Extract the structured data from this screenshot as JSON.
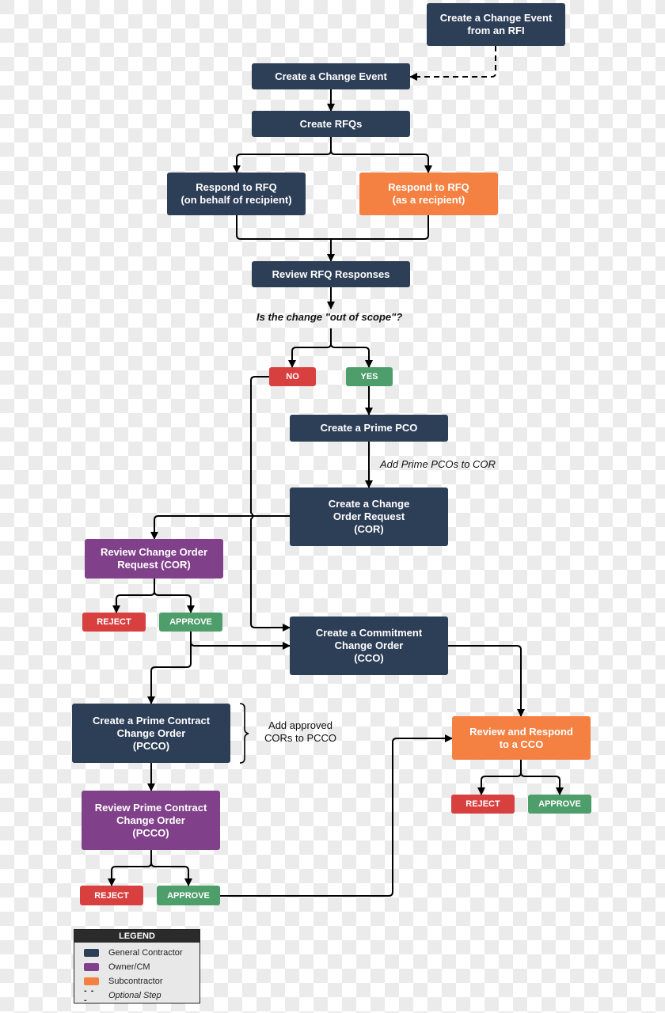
{
  "colors": {
    "general_contractor": "#2d3e57",
    "owner_cm": "#81418a",
    "subcontractor": "#f48042",
    "reject": "#d84040",
    "approve": "#4d9e6a"
  },
  "nodes": {
    "ce_from_rfi": "Create a Change Event\nfrom an RFI",
    "create_ce": "Create a Change Event",
    "create_rfqs": "Create RFQs",
    "respond_behalf": "Respond to RFQ\n(on behalf of recipient)",
    "respond_recipient": "Respond to RFQ\n(as a recipient)",
    "review_rfq": "Review RFQ Responses",
    "no": "NO",
    "yes": "YES",
    "prime_pco": "Create a Prime PCO",
    "create_cor": "Create a Change\nOrder Request\n(COR)",
    "review_cor": "Review Change Order\nRequest (COR)",
    "cor_reject": "REJECT",
    "cor_approve": "APPROVE",
    "create_cco": "Create a Commitment\nChange Order\n(CCO)",
    "create_pcco": "Create a Prime Contract\nChange Order\n(PCCO)",
    "review_pcco": "Review Prime Contract\nChange Order\n(PCCO)",
    "pcco_reject": "REJECT",
    "pcco_approve": "APPROVE",
    "review_cco": "Review and Respond\nto a CCO",
    "cco_reject": "REJECT",
    "cco_approve": "APPROVE"
  },
  "labels": {
    "question": "Is the change \"out of scope\"?",
    "add_pcos": "Add Prime PCOs to COR",
    "add_cors": "Add approved\nCORs to PCCO"
  },
  "legend": {
    "title": "LEGEND",
    "items": [
      {
        "label": "General Contractor",
        "swatch": "general_contractor"
      },
      {
        "label": "Owner/CM",
        "swatch": "owner_cm"
      },
      {
        "label": "Subcontractor",
        "swatch": "subcontractor"
      },
      {
        "label": "Optional Step",
        "swatch": "dashed-line"
      }
    ]
  }
}
